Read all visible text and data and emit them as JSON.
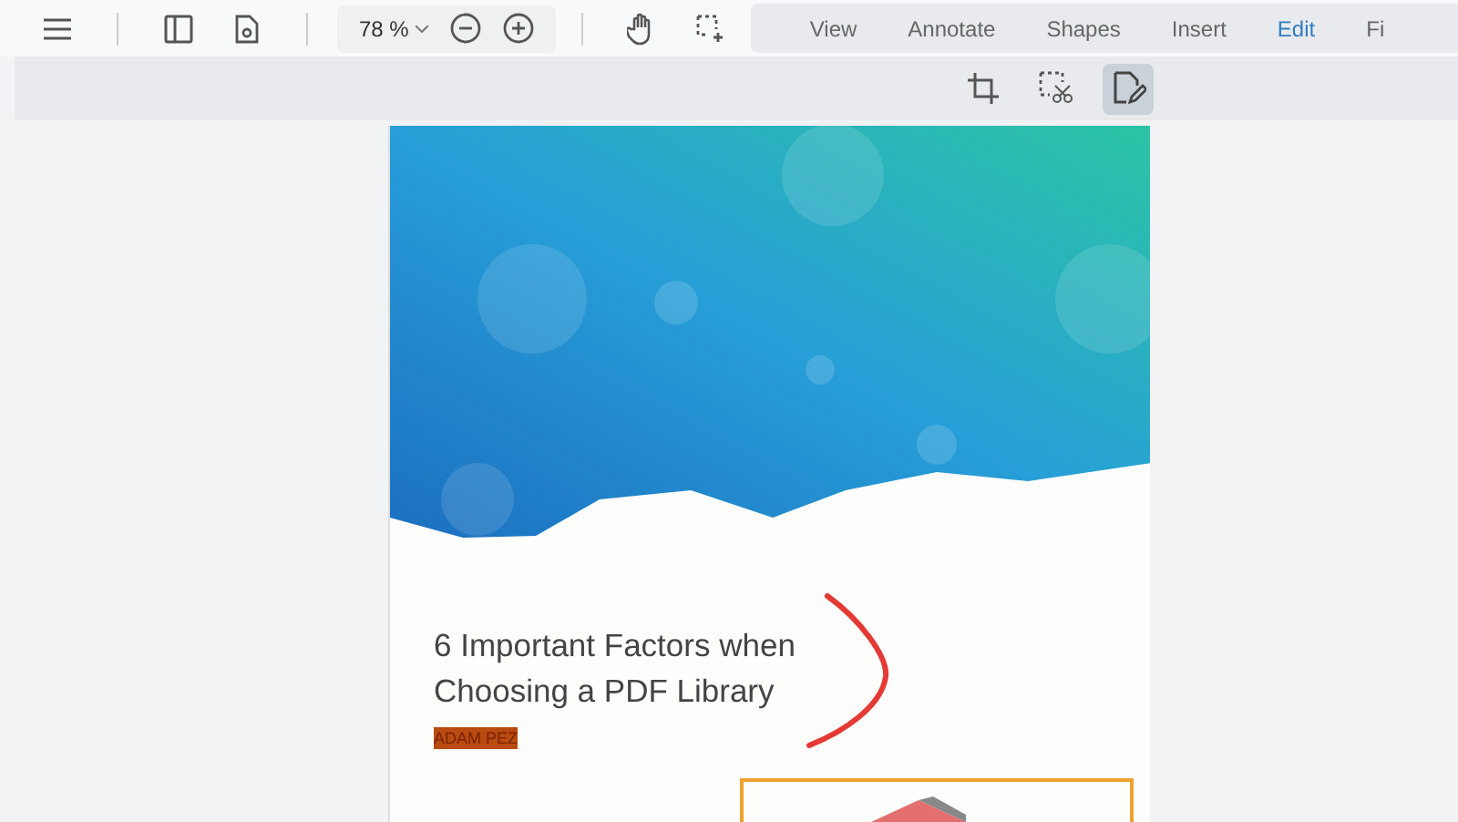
{
  "toolbar": {
    "zoom": "78 %",
    "tabs": [
      {
        "label": "View",
        "selected": false
      },
      {
        "label": "Annotate",
        "selected": false
      },
      {
        "label": "Shapes",
        "selected": false
      },
      {
        "label": "Insert",
        "selected": false
      },
      {
        "label": "Edit",
        "selected": true
      },
      {
        "label": "Fi",
        "selected": false
      }
    ]
  },
  "edit_tools": [
    {
      "kind": "crop",
      "selected": false
    },
    {
      "kind": "redact",
      "selected": false
    },
    {
      "kind": "edit-page",
      "selected": true
    }
  ],
  "document": {
    "title": "6 Important Factors when Choosing a PDF Library",
    "author": "ADAM PEZ"
  }
}
